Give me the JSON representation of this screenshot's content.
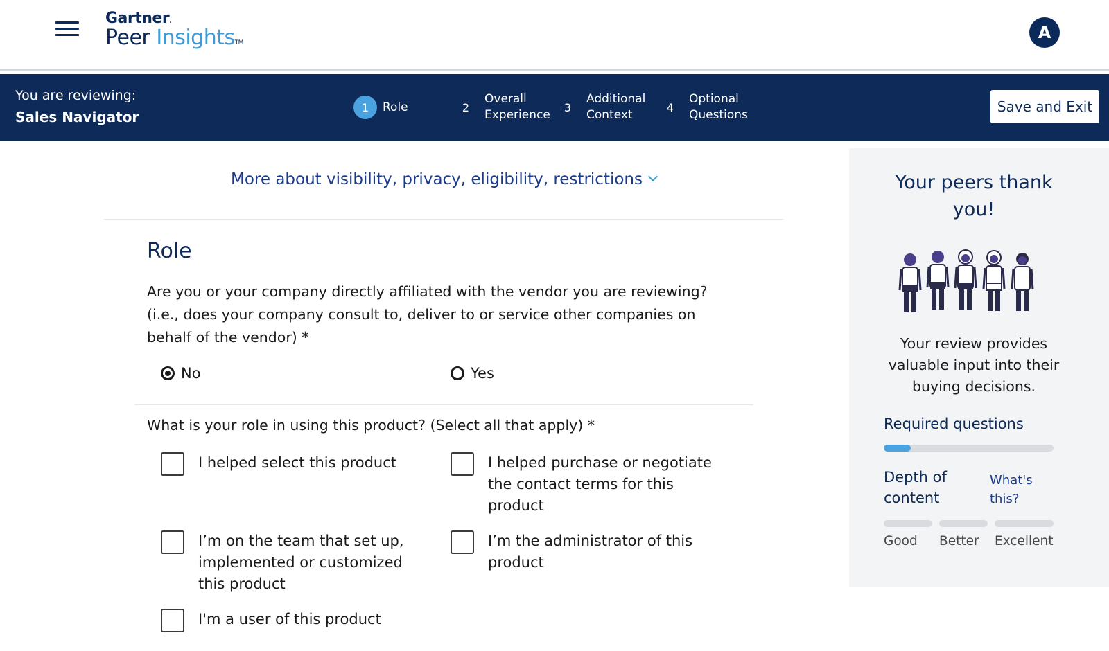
{
  "header": {
    "logo_gartner": "Gartner",
    "logo_peer": "Peer",
    "logo_insights": "Insights",
    "avatar_initial": "A"
  },
  "review_bar": {
    "reviewing_label": "You are reviewing:",
    "product_name": "Sales Navigator",
    "steps": [
      {
        "num": "1",
        "line1": "Role",
        "line2": ""
      },
      {
        "num": "2",
        "line1": "Overall",
        "line2": "Experience"
      },
      {
        "num": "3",
        "line1": "Additional",
        "line2": "Context"
      },
      {
        "num": "4",
        "line1": "Optional",
        "line2": "Questions"
      }
    ],
    "save_exit_label": "Save and Exit"
  },
  "main": {
    "privacy_link": "More about visibility, privacy, eligibility, restrictions",
    "section_title": "Role",
    "q1": {
      "text_line1": "Are you or your company directly affiliated with the vendor you are reviewing?",
      "text_line2": "(i.e., does your company consult to, deliver to or service other companies on",
      "text_line3": "behalf of the vendor) *",
      "options": [
        "No",
        "Yes"
      ],
      "selected": "No"
    },
    "q2": {
      "text": "What is your role in using this product? (Select all that apply) *",
      "options": [
        {
          "line1": "I helped select this product",
          "line2": "",
          "line3": ""
        },
        {
          "line1": "I helped purchase or negotiate",
          "line2": "the contact terms for this",
          "line3": "product"
        },
        {
          "line1": "I’m on the team that set up,",
          "line2": "implemented or customized",
          "line3": "this product"
        },
        {
          "line1": "I’m the administrator of this",
          "line2": "product",
          "line3": ""
        },
        {
          "line1": "I'm a user of this product",
          "line2": "",
          "line3": ""
        }
      ]
    }
  },
  "sidebar": {
    "title_line1": "Your peers thank",
    "title_line2": "you!",
    "text_line1": "Your review provides",
    "text_line2": "valuable input into their",
    "text_line3": "buying decisions.",
    "required_label": "Required questions",
    "required_progress": 0.16,
    "depth_label_line1": "Depth of",
    "depth_label_line2": "content",
    "whats_this_line1": "What's",
    "whats_this_line2": "this?",
    "depth_levels": [
      "Good",
      "Better",
      "Excellent"
    ]
  },
  "colors": {
    "navy": "#0d2a58",
    "accent_blue": "#4aa3df",
    "link_blue": "#1a3a8a"
  }
}
